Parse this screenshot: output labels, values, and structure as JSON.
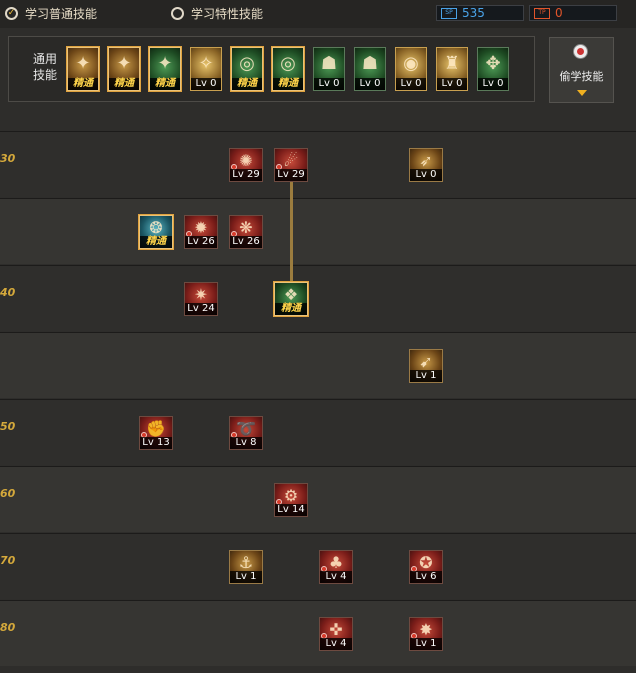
{
  "tabs": [
    {
      "label": "学习普通技能",
      "selected": true,
      "icon": "checkmark-circle-icon"
    },
    {
      "label": "学习特性技能",
      "selected": false,
      "icon": "radio-circle-icon"
    }
  ],
  "sp": {
    "primary": {
      "value": "535",
      "icon_text": "SP",
      "color": "#4aa3e8"
    },
    "secondary": {
      "value": "0",
      "icon_text": "TP",
      "color": "#e0552b"
    }
  },
  "common_skills": {
    "label": "通用技能",
    "items": [
      {
        "lv": "精通",
        "glyph": "✦",
        "style": "yellow",
        "master": true,
        "icon": "crouching-figure-icon"
      },
      {
        "lv": "精通",
        "glyph": "✦",
        "style": "yellow",
        "master": true,
        "icon": "kneeling-figure-icon"
      },
      {
        "lv": "精通",
        "glyph": "✦",
        "style": "green",
        "master": true,
        "icon": "leaping-figure-icon"
      },
      {
        "lv": "Lv 0",
        "glyph": "✧",
        "style": "gold",
        "master": false,
        "icon": "winged-emblem-icon"
      },
      {
        "lv": "精通",
        "glyph": "◎",
        "style": "green",
        "master": true,
        "icon": "crosshair-green-icon"
      },
      {
        "lv": "精通",
        "glyph": "◎",
        "style": "green",
        "master": true,
        "icon": "radar-green-icon"
      },
      {
        "lv": "Lv 0",
        "glyph": "☗",
        "style": "green",
        "master": false,
        "icon": "figure-sprint-icon"
      },
      {
        "lv": "Lv 0",
        "glyph": "☗",
        "style": "green",
        "master": false,
        "icon": "figure-burst-icon"
      },
      {
        "lv": "Lv 0",
        "glyph": "◉",
        "style": "gold",
        "master": false,
        "icon": "concentric-eye-icon"
      },
      {
        "lv": "Lv 0",
        "glyph": "♜",
        "style": "gold",
        "master": false,
        "icon": "golden-figure-icon"
      },
      {
        "lv": "Lv 0",
        "glyph": "✥",
        "style": "green",
        "master": false,
        "icon": "spirit-figure-icon"
      }
    ]
  },
  "steal_button": {
    "label": "偷学技能",
    "icon": "red-orb-icon"
  },
  "level_rows": [
    {
      "label": "30"
    },
    {
      "label": ""
    },
    {
      "label": "40"
    },
    {
      "label": ""
    },
    {
      "label": "50"
    },
    {
      "label": "60"
    },
    {
      "label": "70"
    },
    {
      "label": "80"
    }
  ],
  "tree_skills": [
    {
      "row": 0,
      "col": 2,
      "lv": "Lv 29",
      "glyph": "✺",
      "style": "red",
      "master": false,
      "dot": true,
      "icon": "fist-burst-icon"
    },
    {
      "row": 0,
      "col": 3,
      "lv": "Lv 29",
      "glyph": "☄",
      "style": "red",
      "master": false,
      "dot": true,
      "icon": "grab-skull-icon"
    },
    {
      "row": 0,
      "col": 6,
      "lv": "Lv 0",
      "glyph": "➶",
      "style": "yellow",
      "master": false,
      "dot": false,
      "icon": "dash-kick-icon"
    },
    {
      "row": 1,
      "col": 0,
      "lv": "精通",
      "glyph": "❂",
      "style": "teal",
      "master": true,
      "dot": false,
      "icon": "water-swirl-icon"
    },
    {
      "row": 1,
      "col": 1,
      "lv": "Lv 26",
      "glyph": "✹",
      "style": "red",
      "master": false,
      "dot": true,
      "icon": "flame-slash-icon"
    },
    {
      "row": 1,
      "col": 2,
      "lv": "Lv 26",
      "glyph": "❋",
      "style": "red",
      "master": false,
      "dot": true,
      "icon": "net-throw-icon"
    },
    {
      "row": 2,
      "col": 1,
      "lv": "Lv 24",
      "glyph": "✷",
      "style": "red",
      "master": false,
      "dot": false,
      "icon": "fire-punch-icon"
    },
    {
      "row": 2,
      "col": 3,
      "lv": "精通",
      "glyph": "❖",
      "style": "green",
      "master": true,
      "dot": false,
      "icon": "green-crest-icon"
    },
    {
      "row": 3,
      "col": 6,
      "lv": "Lv 1",
      "glyph": "➹",
      "style": "yellow",
      "master": false,
      "dot": false,
      "icon": "blade-slash-icon"
    },
    {
      "row": 4,
      "col": 0,
      "lv": "Lv 13",
      "glyph": "✊",
      "style": "red",
      "master": false,
      "dot": true,
      "icon": "gauntlet-fist-icon"
    },
    {
      "row": 4,
      "col": 2,
      "lv": "Lv 8",
      "glyph": "➰",
      "style": "red",
      "master": false,
      "dot": true,
      "icon": "spiral-lariat-icon"
    },
    {
      "row": 5,
      "col": 3,
      "lv": "Lv 14",
      "glyph": "⚙",
      "style": "red",
      "master": false,
      "dot": true,
      "icon": "barrel-roll-icon"
    },
    {
      "row": 6,
      "col": 2,
      "lv": "Lv 1",
      "glyph": "⚓",
      "style": "yellow",
      "master": false,
      "dot": false,
      "icon": "anchor-slam-icon"
    },
    {
      "row": 6,
      "col": 4,
      "lv": "Lv 4",
      "glyph": "♣",
      "style": "red",
      "master": false,
      "dot": true,
      "icon": "clover-strike-icon"
    },
    {
      "row": 6,
      "col": 6,
      "lv": "Lv 6",
      "glyph": "✪",
      "style": "red",
      "master": false,
      "dot": true,
      "icon": "dragon-hold-icon"
    },
    {
      "row": 7,
      "col": 4,
      "lv": "Lv 4",
      "glyph": "✜",
      "style": "red",
      "master": false,
      "dot": true,
      "icon": "pillar-strike-icon"
    },
    {
      "row": 7,
      "col": 6,
      "lv": "Lv 1",
      "glyph": "✸",
      "style": "red",
      "master": false,
      "dot": true,
      "icon": "explosion-grab-icon"
    }
  ]
}
